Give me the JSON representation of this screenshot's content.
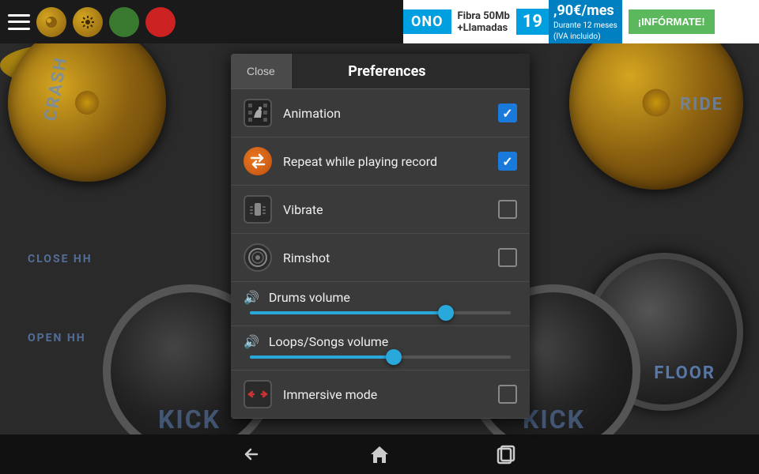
{
  "topbar": {
    "menu_icon": "menu",
    "record_icon": "record",
    "settings_icon": "settings",
    "green_btn": "green",
    "red_btn": "red"
  },
  "ad": {
    "brand": "ONO",
    "tagline": "Fibra 50Mb\n+Llamadas",
    "price": "19,90€/mes",
    "price_note": "Durante 12 meses\n(IVA incluido)",
    "cta": "¡INFÓRMATE!"
  },
  "drumkit": {
    "label_crash": "CRASH",
    "label_closehh": "CLOSE HH",
    "label_openhh": "OPEN HH",
    "label_ride": "RIDE",
    "label_floor": "FLOOR",
    "label_kick1": "KICK",
    "label_kick2": "KICK"
  },
  "preferences": {
    "title": "Preferences",
    "close_label": "Close",
    "items": [
      {
        "id": "animation",
        "label": "Animation",
        "icon": "animation-icon",
        "checked": true
      },
      {
        "id": "repeat",
        "label": "Repeat while playing record",
        "icon": "repeat-icon",
        "checked": true
      },
      {
        "id": "vibrate",
        "label": "Vibrate",
        "icon": "vibrate-icon",
        "checked": false
      },
      {
        "id": "rimshot",
        "label": "Rimshot",
        "icon": "rimshot-icon",
        "checked": false
      }
    ],
    "drums_volume": {
      "label": "Drums volume",
      "value": 75
    },
    "loops_volume": {
      "label": "Loops/Songs volume",
      "value": 55
    },
    "immersive": {
      "label": "Immersive mode",
      "icon": "immersive-icon",
      "checked": false
    }
  },
  "bottombar": {
    "back_label": "back",
    "home_label": "home",
    "recents_label": "recents"
  }
}
